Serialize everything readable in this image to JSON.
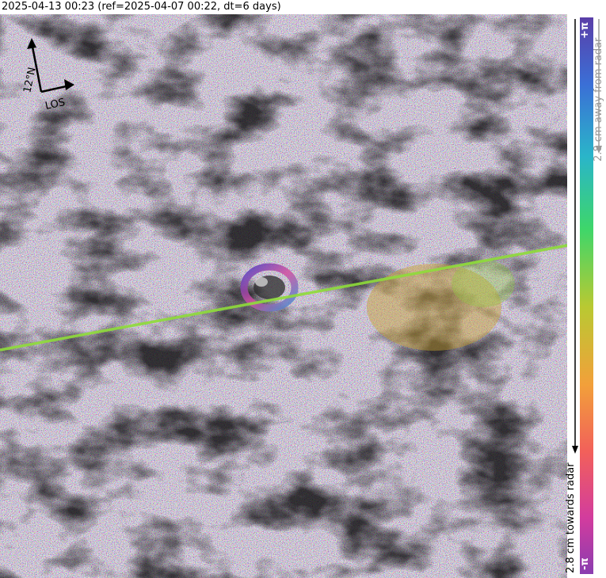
{
  "title": "2025-04-13 00:23 (ref=2025-04-07 00:22, dt=6 days)",
  "compass": {
    "north_label": "12°N",
    "los_label": "LOS",
    "north_icon": "north-arrow-icon",
    "los_icon": "los-arrow-icon"
  },
  "colorbar": {
    "top_label": "+π",
    "bottom_label": "-π",
    "away_label": "2.8 cm away from radar",
    "towards_label": "2.8 cm towards radar",
    "colors": [
      "#5a3ea8",
      "#3b6fd6",
      "#2ab5c9",
      "#3ed66a",
      "#b9c932",
      "#f2a03a",
      "#f2605a",
      "#d23c9e",
      "#8a3db0"
    ]
  }
}
